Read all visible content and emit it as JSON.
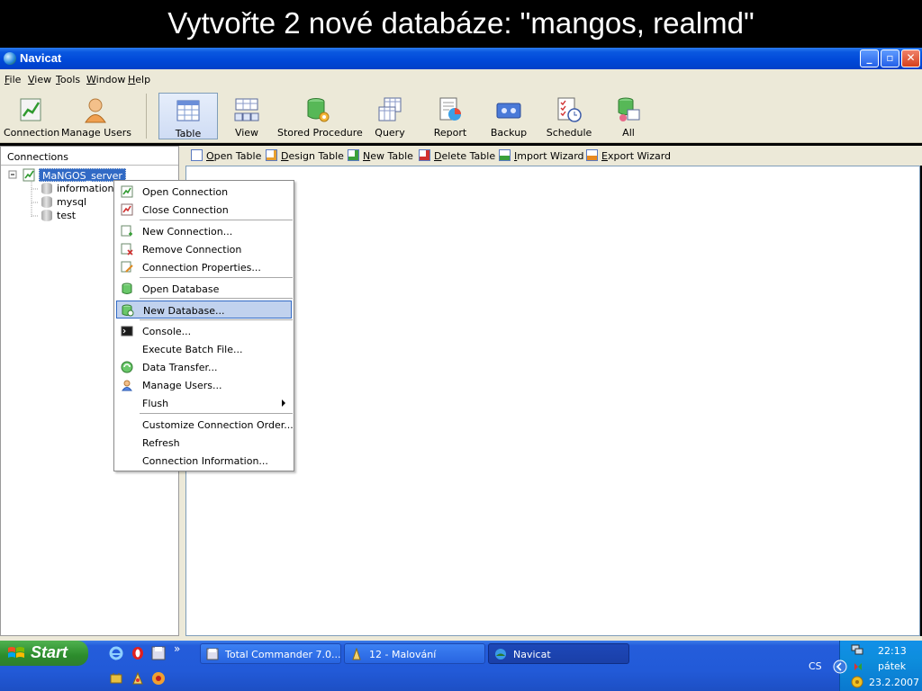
{
  "banner": {
    "text": "Vytvořte 2 nové databáze: \"mangos, realmd\""
  },
  "window": {
    "title": "Navicat",
    "minimize": "_",
    "maximize": "▫",
    "close": "✕"
  },
  "menubar": [
    {
      "prefix": "",
      "u": "F",
      "rest": "ile"
    },
    {
      "prefix": "",
      "u": "V",
      "rest": "iew"
    },
    {
      "prefix": "",
      "u": "T",
      "rest": "ools"
    },
    {
      "prefix": "",
      "u": "W",
      "rest": "indow"
    },
    {
      "prefix": "",
      "u": "H",
      "rest": "elp"
    }
  ],
  "toolbar": {
    "connection": "Connection",
    "manage_users": "Manage Users",
    "table": "Table",
    "view": "View",
    "stored_procedure": "Stored Procedure",
    "query": "Query",
    "report": "Report",
    "backup": "Backup",
    "schedule": "Schedule",
    "all": "All",
    "active": "Table"
  },
  "connections_panel": {
    "header": "Connections",
    "server": "MaNGOS_server",
    "databases": [
      "information_s",
      "mysql",
      "test"
    ]
  },
  "subtoolbar": [
    {
      "u": "O",
      "rest": "pen Table"
    },
    {
      "u": "D",
      "rest": "esign Table"
    },
    {
      "u": "N",
      "rest": "ew Table"
    },
    {
      "u": "D",
      "rest": "elete Table"
    },
    {
      "u": "I",
      "rest": "mport Wizard"
    },
    {
      "u": "E",
      "rest": "xport Wizard"
    }
  ],
  "context_menu": {
    "open_connection": "Open Connection",
    "close_connection": "Close Connection",
    "new_connection": "New Connection...",
    "remove_connection": "Remove Connection",
    "connection_properties": "Connection Properties...",
    "open_database": "Open Database",
    "new_database": "New Database...",
    "console": "Console...",
    "execute_batch": "Execute Batch File...",
    "data_transfer": "Data Transfer...",
    "manage_users": "Manage Users...",
    "flush": "Flush",
    "customize_order": "Customize Connection Order...",
    "refresh": "Refresh",
    "connection_information": "Connection Information...",
    "highlighted": "New Database..."
  },
  "taskbar": {
    "start": "Start",
    "tasks": [
      "Total Commander 7.0...",
      "12 - Malování",
      "Navicat"
    ],
    "active_task": "Navicat",
    "lang": "CS",
    "time": "22:13",
    "day": "pátek",
    "date": "23.2.2007",
    "overflow": "»"
  }
}
